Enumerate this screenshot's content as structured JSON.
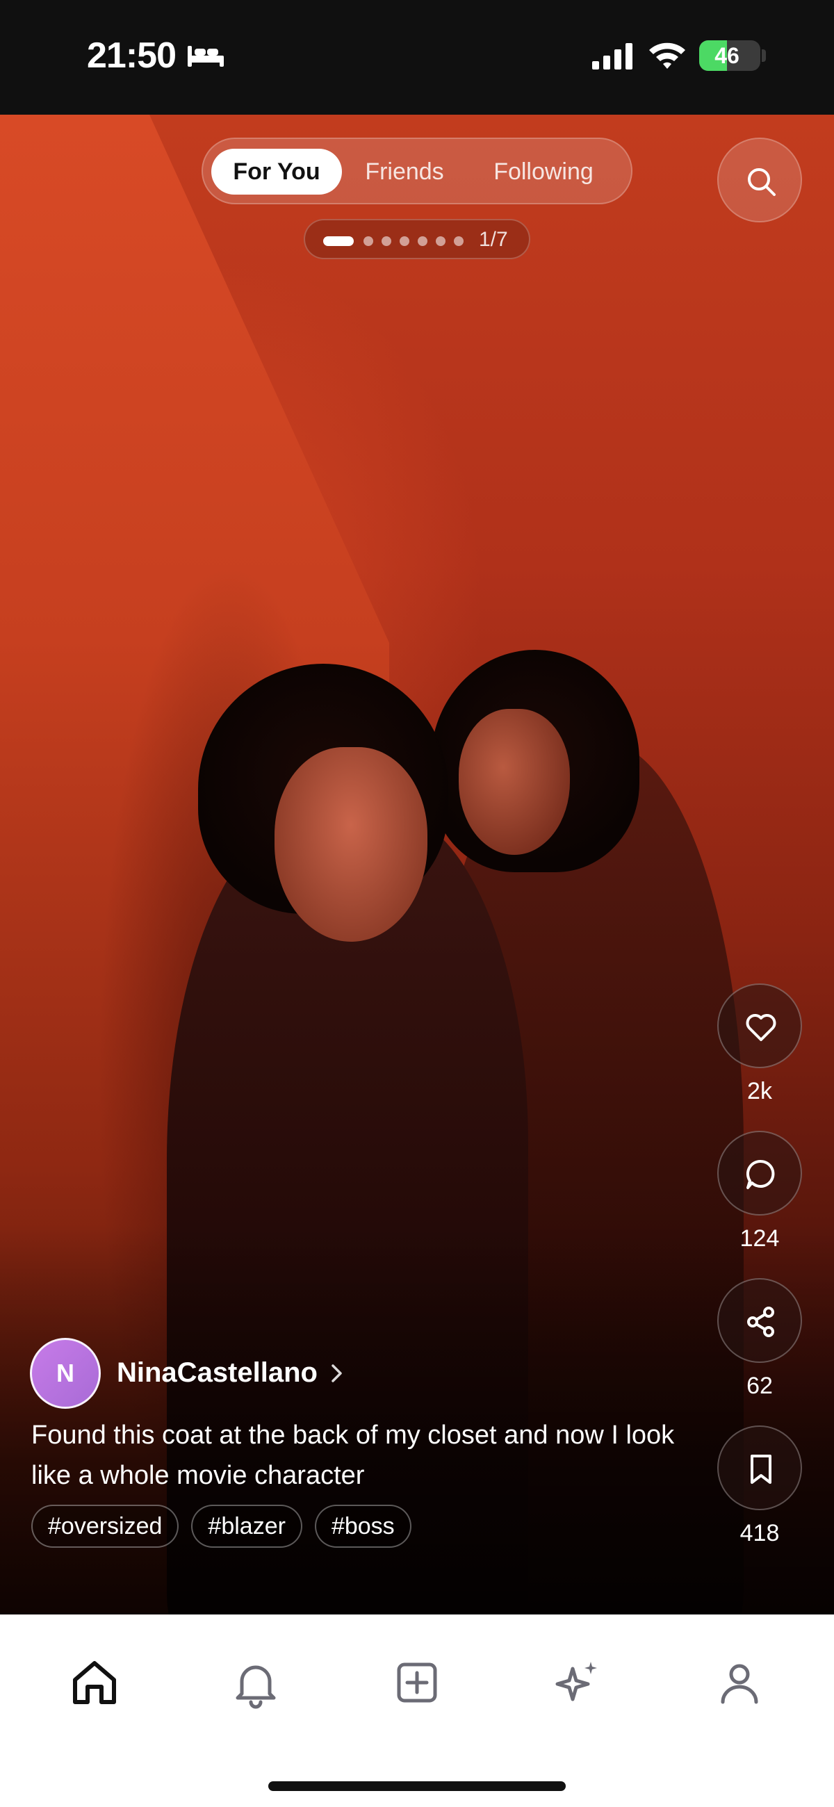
{
  "status_bar": {
    "time": "21:50",
    "sleep_icon": "bed-icon",
    "battery_percent": "46",
    "battery_level": 0.46,
    "battery_charging": true
  },
  "feed_tabs": {
    "items": [
      "For You",
      "Friends",
      "Following"
    ],
    "active": "For You"
  },
  "page_indicator": {
    "current": 1,
    "total": 7,
    "label": "1/7"
  },
  "search": {
    "icon": "search-icon"
  },
  "actions": {
    "like": {
      "icon": "heart-icon",
      "count": "2k"
    },
    "comment": {
      "icon": "comment-bubble-icon",
      "count": "124"
    },
    "share": {
      "icon": "share-icon",
      "count": "62"
    },
    "save": {
      "icon": "bookmark-icon",
      "count": "418"
    }
  },
  "post": {
    "author": {
      "initial": "N",
      "name": "NinaCastellano"
    },
    "caption": "Found this coat at the back of my closet and now I look like a whole movie character",
    "hashtags": [
      "#oversized",
      "#blazer",
      "#boss"
    ]
  },
  "bottom_nav": {
    "items": [
      "home-icon",
      "bell-icon",
      "add-post-icon",
      "sparkles-icon",
      "profile-icon"
    ],
    "active": "home-icon"
  },
  "colors": {
    "photo_red": "#c23c1e",
    "avatar_purple": "#b873e0",
    "battery_green": "#4cd964"
  }
}
